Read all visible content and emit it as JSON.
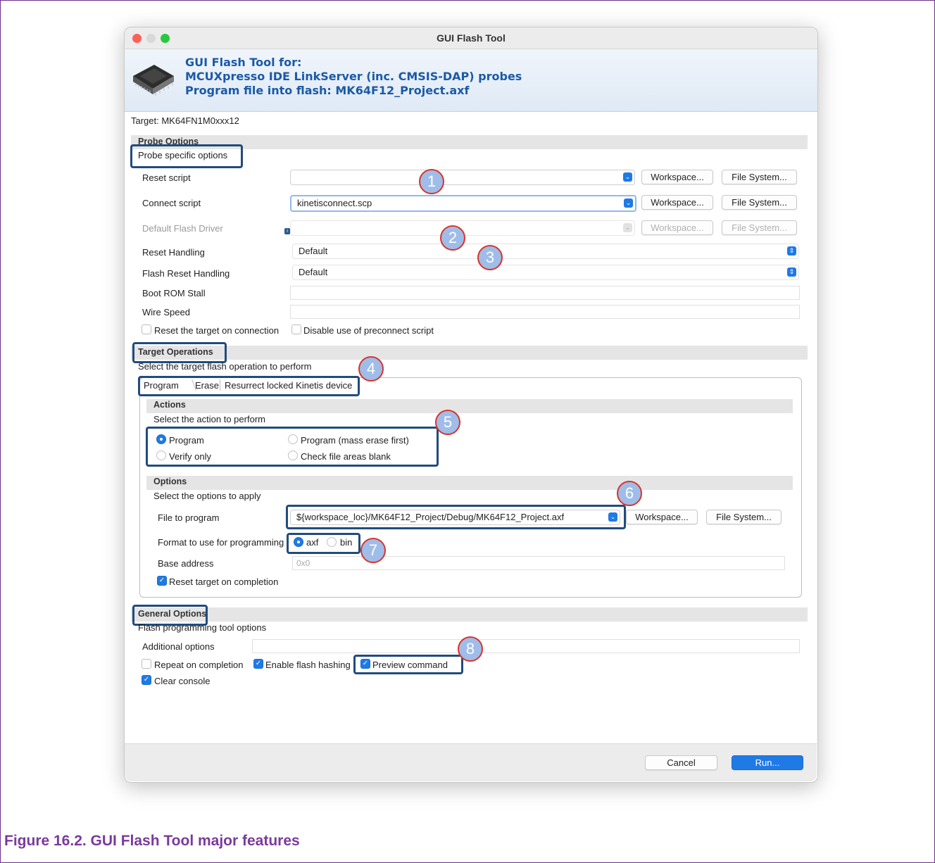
{
  "window": {
    "title": "GUI Flash Tool"
  },
  "banner": {
    "line1": "GUI Flash Tool for:",
    "line2": "MCUXpresso IDE LinkServer (inc. CMSIS-DAP) probes",
    "line3": "Program file into flash: MK64F12_Project.axf"
  },
  "target": "Target: MK64FN1M0xxx12",
  "probe": {
    "section_title": "Probe Options",
    "subtitle": "Probe specific options",
    "reset_script_label": "Reset script",
    "reset_script_value": "",
    "connect_script_label": "Connect script",
    "connect_script_value": "kinetisconnect.scp",
    "flash_driver_label": "Default Flash Driver",
    "reset_handling_label": "Reset Handling",
    "reset_handling_value": "Default",
    "flash_reset_label": "Flash Reset Handling",
    "flash_reset_value": "Default",
    "boot_rom_label": "Boot ROM Stall",
    "wire_speed_label": "Wire Speed",
    "reset_on_connect_label": "Reset the target on connection",
    "reset_on_connect_checked": false,
    "disable_preconnect_label": "Disable use of preconnect script",
    "disable_preconnect_checked": false,
    "workspace_label": "Workspace...",
    "filesystem_label": "File System..."
  },
  "target_ops": {
    "section_title": "Target Operations",
    "subtitle": "Select the target flash operation to perform",
    "tabs": [
      "Program",
      "Erase",
      "Resurrect locked Kinetis device"
    ],
    "active_tab": "Program",
    "actions_title": "Actions",
    "actions_subtitle": "Select the action to perform",
    "radio_program": "Program",
    "radio_program_mass": "Program (mass erase first)",
    "radio_verify": "Verify only",
    "radio_blank": "Check file areas blank",
    "selected_action": "Program",
    "options_title": "Options",
    "options_subtitle": "Select the options to apply",
    "file_label": "File to program",
    "file_value": "${workspace_loc}/MK64F12_Project/Debug/MK64F12_Project.axf",
    "format_label": "Format to use for programming",
    "format_axf": "axf",
    "format_bin": "bin",
    "selected_format": "axf",
    "base_label": "Base address",
    "base_placeholder": "0x0",
    "reset_completion_label": "Reset target on completion",
    "reset_completion_checked": true
  },
  "general": {
    "section_title": "General Options",
    "subtitle": "Flash programming tool options",
    "additional_label": "Additional options",
    "repeat_label": "Repeat on completion",
    "repeat_checked": false,
    "hashing_label": "Enable flash hashing",
    "hashing_checked": true,
    "preview_label": "Preview command",
    "preview_checked": true,
    "clear_label": "Clear console",
    "clear_checked": true
  },
  "footer": {
    "cancel_label": "Cancel",
    "run_label": "Run..."
  },
  "callouts": [
    "1",
    "2",
    "3",
    "4",
    "5",
    "6",
    "7",
    "8"
  ],
  "caption": "Figure 16.2. GUI Flash Tool major features",
  "colors": {
    "accent": "#1f7ae6",
    "highlight": "#214c7d",
    "callout_border": "#d9342b",
    "caption": "#7a3a9c"
  }
}
